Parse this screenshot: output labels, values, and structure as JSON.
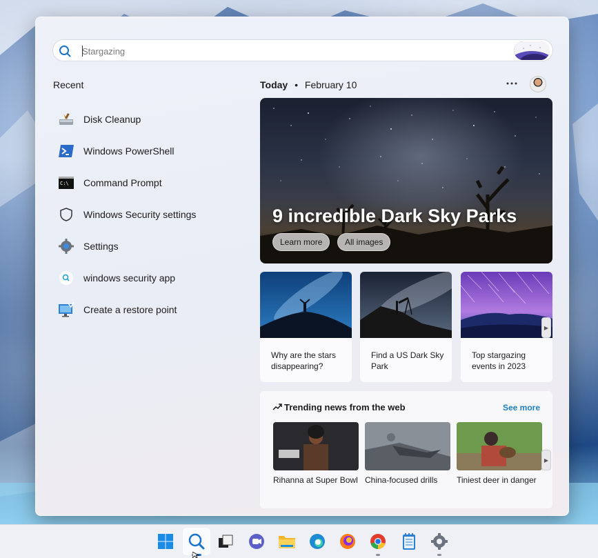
{
  "search": {
    "placeholder": "Stargazing"
  },
  "recent": {
    "title": "Recent",
    "items": [
      {
        "label": "Disk Cleanup",
        "icon": "disk-cleanup-icon"
      },
      {
        "label": "Windows PowerShell",
        "icon": "powershell-icon"
      },
      {
        "label": "Command Prompt",
        "icon": "command-prompt-icon"
      },
      {
        "label": "Windows Security settings",
        "icon": "shield-icon"
      },
      {
        "label": "Settings",
        "icon": "gear-icon"
      },
      {
        "label": "windows security app",
        "icon": "search-icon"
      },
      {
        "label": "Create a restore point",
        "icon": "system-restore-icon"
      }
    ]
  },
  "today": {
    "label": "Today",
    "separator": "•",
    "date": "February 10"
  },
  "hero": {
    "title": "9 incredible Dark Sky Parks",
    "learn_more": "Learn more",
    "all_images": "All images"
  },
  "cards": [
    {
      "text": "Why are the stars disappearing?"
    },
    {
      "text": "Find a US Dark Sky Park"
    },
    {
      "text": "Top stargazing events in 2023"
    }
  ],
  "trending": {
    "title": "Trending news from the web",
    "see_more": "See more",
    "items": [
      {
        "text": "Rihanna at Super Bowl"
      },
      {
        "text": "China-focused drills"
      },
      {
        "text": "Tiniest deer in danger"
      }
    ]
  },
  "taskbar": {
    "items": [
      "windows-start-icon",
      "search-icon",
      "task-view-icon",
      "chat-icon",
      "file-explorer-icon",
      "edge-icon",
      "firefox-icon",
      "chrome-icon",
      "notepad-icon",
      "settings-gear-icon"
    ]
  },
  "colors": {
    "accent": "#1a73c8",
    "see_more": "#1d7fbf"
  }
}
